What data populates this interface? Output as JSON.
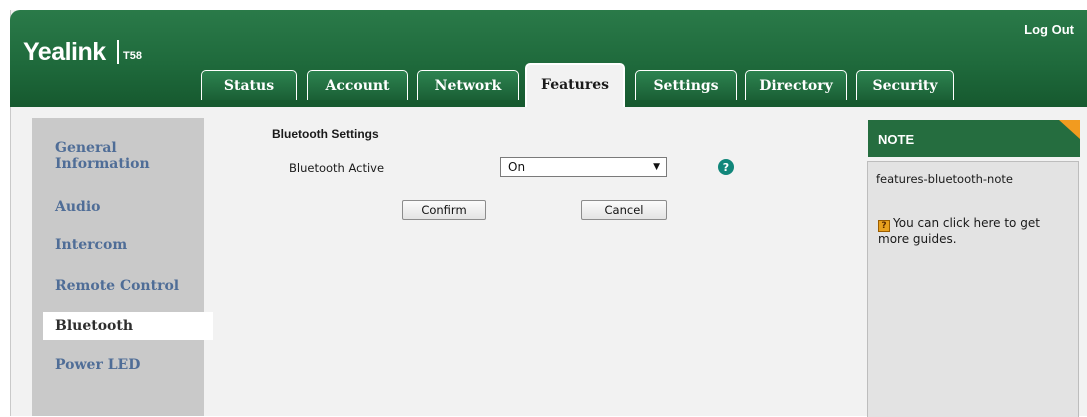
{
  "header": {
    "brand": "Yealink",
    "model": "T58",
    "logout_label": "Log Out"
  },
  "tabs": [
    {
      "label": "Status",
      "active": false
    },
    {
      "label": "Account",
      "active": false
    },
    {
      "label": "Network",
      "active": false
    },
    {
      "label": "Features",
      "active": true
    },
    {
      "label": "Settings",
      "active": false
    },
    {
      "label": "Directory",
      "active": false
    },
    {
      "label": "Security",
      "active": false
    }
  ],
  "sidebar": {
    "items": [
      {
        "label": "General Information",
        "active": false
      },
      {
        "label": "Audio",
        "active": false
      },
      {
        "label": "Intercom",
        "active": false
      },
      {
        "label": "Remote Control",
        "active": false
      },
      {
        "label": "Bluetooth",
        "active": true
      },
      {
        "label": "Power LED",
        "active": false
      }
    ]
  },
  "form": {
    "section_title": "Bluetooth Settings",
    "field_label": "Bluetooth Active",
    "field_value": "On",
    "help_glyph": "?",
    "confirm_label": "Confirm",
    "cancel_label": "Cancel"
  },
  "note": {
    "title": "NOTE",
    "key": "features-bluetooth-note",
    "guide_text": "You can click here to get more guides."
  },
  "colors": {
    "header_green": "#1f6a3c",
    "nav_text": "#4f6d97",
    "help_icon": "#11867a",
    "note_corner": "#f29b1f"
  }
}
